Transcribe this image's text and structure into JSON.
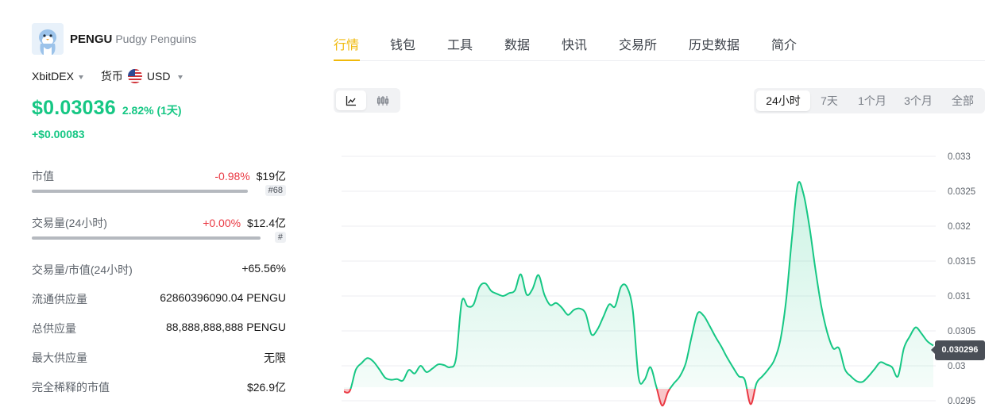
{
  "coin": {
    "symbol": "PENGU",
    "name": "Pudgy Penguins",
    "exchange": "XbitDEX",
    "currency_label": "货币",
    "currency": "USD",
    "price": "$0.03036",
    "change_pct": "2.82% (1天)",
    "change_abs": "+$0.00083"
  },
  "stats": [
    {
      "label": "市值",
      "change": "-0.98%",
      "value": "$19亿",
      "rank": "#68",
      "bar_fraction": 0.85
    },
    {
      "label": "交易量(24小时)",
      "change": "+0.00%",
      "value": "$12.4亿",
      "rank": "#",
      "bar_fraction": 0.9
    },
    {
      "label": "交易量/市值(24小时)",
      "value": "+65.56%"
    },
    {
      "label": "流通供应量",
      "value": "62860396090.04 PENGU"
    },
    {
      "label": "总供应量",
      "value": "88,888,888,888 PENGU"
    },
    {
      "label": "最大供应量",
      "value": "无限"
    },
    {
      "label": "完全稀释的市值",
      "value": "$26.9亿"
    }
  ],
  "tabs": [
    "行情",
    "钱包",
    "工具",
    "数据",
    "快讯",
    "交易所",
    "历史数据",
    "简介"
  ],
  "active_tab": "行情",
  "chart_types": {
    "line": "line-chart-icon",
    "candle": "candlestick-icon"
  },
  "ranges": [
    "24小时",
    "7天",
    "1个月",
    "3个月",
    "全部"
  ],
  "active_range": "24小时",
  "colors": {
    "up": "#16c784",
    "down": "#ea3943",
    "accent": "#f0b90b"
  },
  "chart_data": {
    "type": "area",
    "title": "",
    "xlabel": "",
    "ylabel": "",
    "ylim": [
      0.02945,
      0.0332
    ],
    "yticks": [
      "0.033",
      "0.0325",
      "0.032",
      "0.0315",
      "0.031",
      "0.0305",
      "0.03",
      "0.0295"
    ],
    "baseline": 0.02967,
    "current_value": "0.030296",
    "series": [
      {
        "values": [
          0.02963,
          0.02964,
          0.02994,
          0.03004,
          0.03011,
          0.03006,
          0.02995,
          0.02983,
          0.0298,
          0.02981,
          0.02979,
          0.02994,
          0.02989,
          0.03,
          0.02991,
          0.02996,
          0.03002,
          0.03001,
          0.02998,
          0.0301,
          0.03092,
          0.03085,
          0.03088,
          0.03113,
          0.03118,
          0.03107,
          0.03103,
          0.031,
          0.03104,
          0.03108,
          0.03131,
          0.03102,
          0.0311,
          0.0313,
          0.03102,
          0.03087,
          0.0309,
          0.03083,
          0.03073,
          0.0308,
          0.03082,
          0.03075,
          0.03045,
          0.03052,
          0.0307,
          0.03088,
          0.03085,
          0.03113,
          0.03113,
          0.0308,
          0.02983,
          0.0298,
          0.02998,
          0.0297,
          0.02943,
          0.02963,
          0.02975,
          0.02985,
          0.03004,
          0.03042,
          0.03075,
          0.03072,
          0.03058,
          0.03042,
          0.03028,
          0.03012,
          0.02998,
          0.02985,
          0.0298,
          0.02945,
          0.02975,
          0.02985,
          0.02995,
          0.03008,
          0.03035,
          0.03092,
          0.03182,
          0.0326,
          0.03245,
          0.03198,
          0.03138,
          0.03085,
          0.03048,
          0.03025,
          0.03025,
          0.02995,
          0.02985,
          0.02978,
          0.02977,
          0.02985,
          0.02995,
          0.03005,
          0.03002,
          0.02998,
          0.02985,
          0.03025,
          0.03042,
          0.03055,
          0.03046,
          0.03035,
          0.03029
        ]
      }
    ]
  }
}
